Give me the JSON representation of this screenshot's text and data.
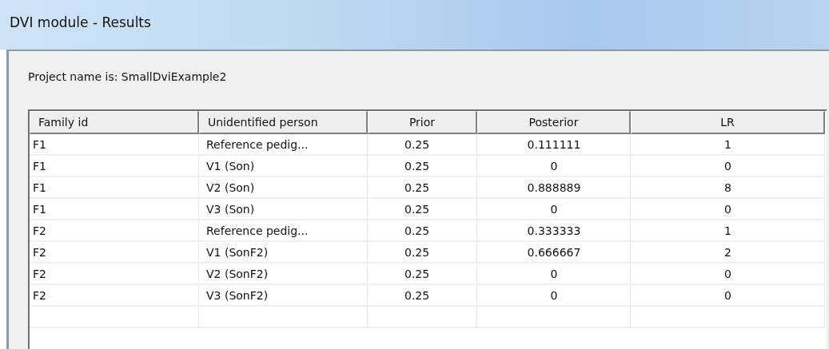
{
  "window": {
    "title": "DVI module - Results"
  },
  "project_label": "Project name is: SmallDviExample2",
  "table": {
    "columns": [
      {
        "label": "Family id"
      },
      {
        "label": "Unidentified person"
      },
      {
        "label": "Prior"
      },
      {
        "label": "Posterior"
      },
      {
        "label": "LR"
      }
    ],
    "rows": [
      [
        "F1",
        "Reference pedig...",
        "0.25",
        "0.111111",
        "1"
      ],
      [
        "F1",
        "V1 (Son)",
        "0.25",
        "0",
        "0"
      ],
      [
        "F1",
        "V2 (Son)",
        "0.25",
        "0.888889",
        "8"
      ],
      [
        "F1",
        "V3 (Son)",
        "0.25",
        "0",
        "0"
      ],
      [
        "F2",
        "Reference pedig...",
        "0.25",
        "0.333333",
        "1"
      ],
      [
        "F2",
        "V1 (SonF2)",
        "0.25",
        "0.666667",
        "2"
      ],
      [
        "F2",
        "V2 (SonF2)",
        "0.25",
        "0",
        "0"
      ],
      [
        "F2",
        "V3 (SonF2)",
        "0.25",
        "0",
        "0"
      ]
    ]
  }
}
